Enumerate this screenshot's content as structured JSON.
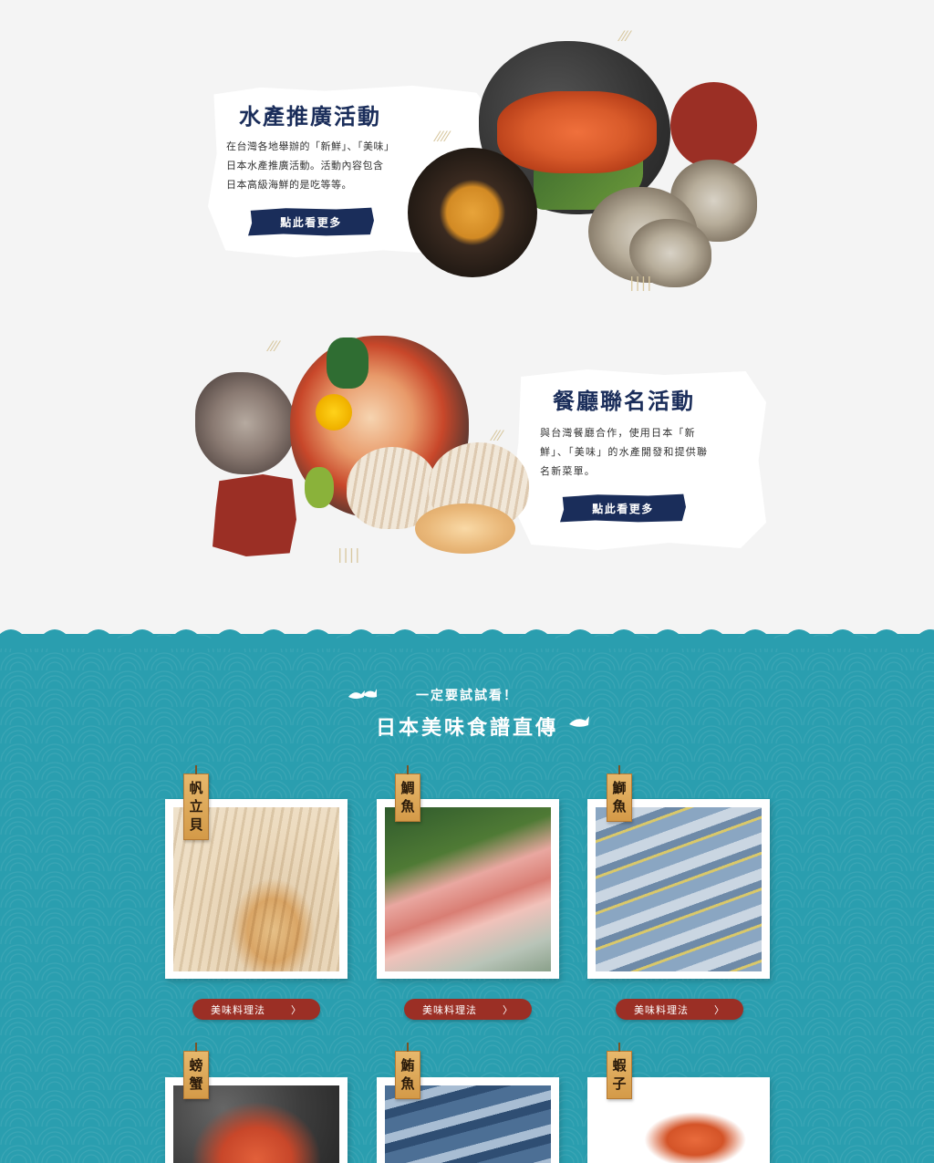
{
  "promo": {
    "title": "水產推廣活動",
    "desc_lines": [
      "在台灣各地舉辦的「新鮮」、「美味」",
      "日本水產推廣活動。活動內容包含",
      "日本高級海鮮的是吃等等。"
    ],
    "button": "點此看更多"
  },
  "collab": {
    "title": "餐廳聯名活動",
    "desc_lines": [
      "與台灣餐廳合作，使用日本「新",
      "鮮」、「美味」的水產開發和提供聯",
      "名新菜單。"
    ],
    "button": "點此看更多"
  },
  "recipes": {
    "subtitle": "一定要試試看！",
    "title": "日本美味食譜直傳",
    "button_label": "美味料理法",
    "items": [
      {
        "name": "帆立貝",
        "chars": [
          "帆",
          "立",
          "貝"
        ]
      },
      {
        "name": "鯛魚",
        "chars": [
          "鯛",
          "魚"
        ]
      },
      {
        "name": "鰤魚",
        "chars": [
          "鰤",
          "魚"
        ]
      },
      {
        "name": "螃蟹",
        "chars": [
          "螃",
          "蟹"
        ]
      },
      {
        "name": "鮪魚",
        "chars": [
          "鮪",
          "魚"
        ]
      },
      {
        "name": "蝦子",
        "chars": [
          "蝦",
          "子"
        ]
      }
    ]
  },
  "colors": {
    "navy": "#1a2d5a",
    "brick": "#9b2f25",
    "teal": "#2a9eaf",
    "wood": "#d49a48"
  },
  "icons": {
    "fish": "fish-icon",
    "chevron": "chevron-right-icon"
  }
}
